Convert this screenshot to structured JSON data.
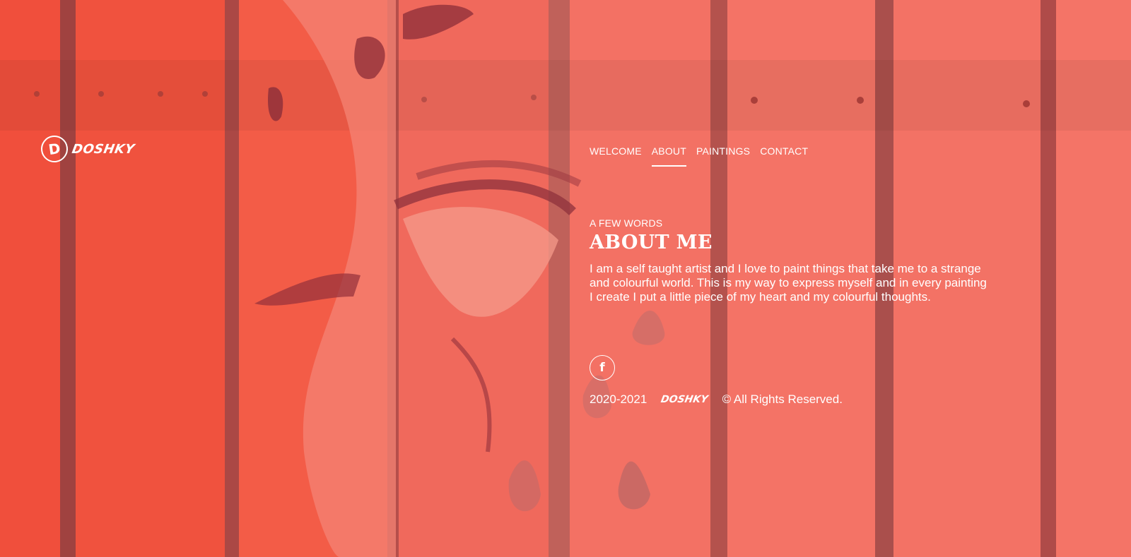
{
  "logo": {
    "mark": "D",
    "wordmark": "DOSHKY"
  },
  "nav": {
    "items": [
      {
        "label": "WELCOME"
      },
      {
        "label": "ABOUT",
        "active": true
      },
      {
        "label": "PAINTINGS"
      },
      {
        "label": "CONTACT"
      }
    ]
  },
  "about": {
    "eyebrow": "A FEW WORDS",
    "title": "ABOUT ME",
    "body": "I am a self taught artist and I love to paint things that take me to a strange and colourful world. This is my way to express myself and in every painting I create I put a little piece of my heart and my colourful thoughts."
  },
  "social": {
    "facebook_glyph": "f",
    "facebook_icon": "facebook-icon"
  },
  "footer": {
    "years": "2020-2021",
    "brand": "DOSHKY",
    "rights": "© All Rights Reserved."
  },
  "colors": {
    "overlay": "#f26b5e",
    "text": "#ffffff"
  }
}
